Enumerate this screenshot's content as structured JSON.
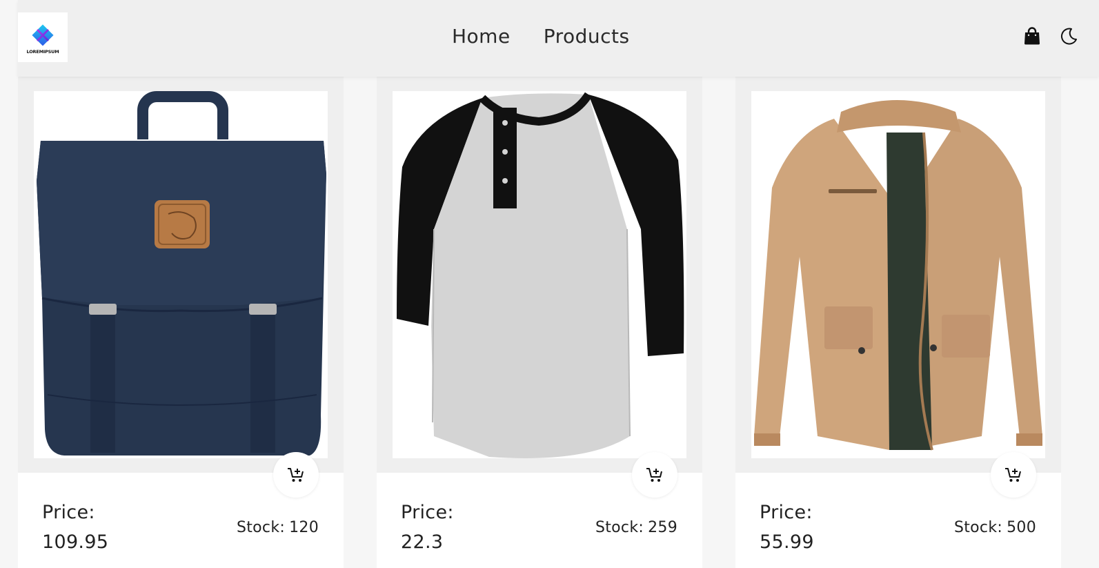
{
  "brand": {
    "logo_text": "LOREMIPSUM",
    "logo_icon": "diamond-cross-logo"
  },
  "nav": {
    "links": [
      {
        "label": "Home"
      },
      {
        "label": "Products"
      }
    ],
    "icons": [
      {
        "name": "shopping-bag-icon"
      },
      {
        "name": "moon-icon"
      }
    ]
  },
  "products": [
    {
      "image_icon": "backpack",
      "price_label": "Price:",
      "price": "109.95",
      "stock_label": "Stock:",
      "stock": "120",
      "cart_icon": "add-to-cart-icon"
    },
    {
      "image_icon": "raglan-tshirt",
      "price_label": "Price:",
      "price": "22.3",
      "stock_label": "Stock:",
      "stock": "259",
      "cart_icon": "add-to-cart-icon"
    },
    {
      "image_icon": "jacket",
      "price_label": "Price:",
      "price": "55.99",
      "stock_label": "Stock:",
      "stock": "500",
      "cart_icon": "add-to-cart-icon"
    }
  ],
  "colors": {
    "navbar_bg": "#efefef",
    "card_frame": "#efefef",
    "page_bg": "#f6f6f6",
    "backpack": "#24344f",
    "jacket": "#cfa57c"
  }
}
